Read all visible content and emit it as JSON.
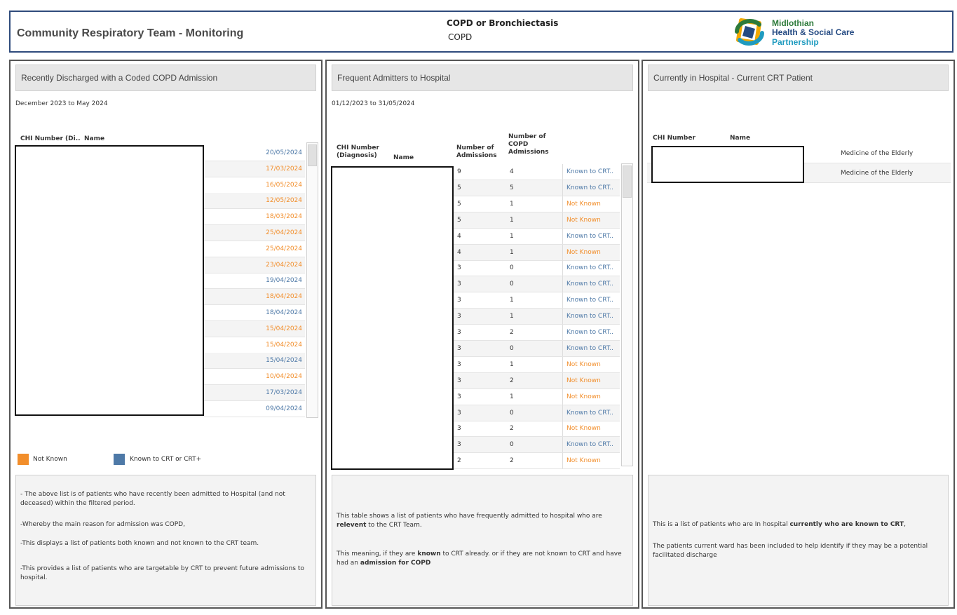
{
  "header": {
    "title": "Community Respiratory Team - Monitoring",
    "filter_primary": "COPD or Bronchiectasis",
    "filter_secondary": "COPD",
    "logo_line1": "Midlothian",
    "logo_line2": "Health & Social Care",
    "logo_line3": "Partnership"
  },
  "colors": {
    "not_known": "#f28e2b",
    "known": "#4e79a7",
    "header_border": "#2f4b7c"
  },
  "panel1": {
    "title": "Recently Discharged with a Coded COPD Admission",
    "period": "December 2023 to May 2024",
    "col_chi": "CHI Number (Di..",
    "col_name": "Name",
    "rows": [
      {
        "date": "20/05/2024",
        "status": "known"
      },
      {
        "date": "17/03/2024",
        "status": "not_known"
      },
      {
        "date": "16/05/2024",
        "status": "not_known"
      },
      {
        "date": "12/05/2024",
        "status": "not_known"
      },
      {
        "date": "18/03/2024",
        "status": "not_known"
      },
      {
        "date": "25/04/2024",
        "status": "not_known"
      },
      {
        "date": "25/04/2024",
        "status": "not_known"
      },
      {
        "date": "23/04/2024",
        "status": "not_known"
      },
      {
        "date": "19/04/2024",
        "status": "known"
      },
      {
        "date": "18/04/2024",
        "status": "not_known"
      },
      {
        "date": "18/04/2024",
        "status": "known"
      },
      {
        "date": "15/04/2024",
        "status": "not_known"
      },
      {
        "date": "15/04/2024",
        "status": "not_known"
      },
      {
        "date": "15/04/2024",
        "status": "known"
      },
      {
        "date": "10/04/2024",
        "status": "not_known"
      },
      {
        "date": "17/03/2024",
        "status": "known"
      },
      {
        "date": "09/04/2024",
        "status": "known"
      }
    ],
    "legend": {
      "not_known": "Not Known",
      "known": "Known to CRT or CRT+"
    },
    "notes": [
      "- The above list is of patients who have recently been admitted to Hospital (and not deceased) within the filtered period.",
      "-Whereby the main reason for admission was COPD,",
      "-This displays a list of patients both known and not known to the CRT team.",
      "-This provides a list of patients who are targetable by CRT to prevent future admissions to hospital."
    ]
  },
  "panel2": {
    "title": "Frequent Admitters to Hospital",
    "period": "01/12/2023 to 31/05/2024",
    "col_chi": "CHI Number (Diagnosis)",
    "col_name": "Name",
    "col_adm": "Number of Admissions",
    "col_copd": "Number of COPD Admissions",
    "rows": [
      {
        "adm": "9",
        "copd": "4",
        "status": "Known to CRT..",
        "kind": "known"
      },
      {
        "adm": "5",
        "copd": "5",
        "status": "Known to CRT..",
        "kind": "known"
      },
      {
        "adm": "5",
        "copd": "1",
        "status": "Not Known",
        "kind": "not_known"
      },
      {
        "adm": "5",
        "copd": "1",
        "status": "Not Known",
        "kind": "not_known"
      },
      {
        "adm": "4",
        "copd": "1",
        "status": "Known to CRT..",
        "kind": "known"
      },
      {
        "adm": "4",
        "copd": "1",
        "status": "Not Known",
        "kind": "not_known"
      },
      {
        "adm": "3",
        "copd": "0",
        "status": "Known to CRT..",
        "kind": "known"
      },
      {
        "adm": "3",
        "copd": "0",
        "status": "Known to CRT..",
        "kind": "known"
      },
      {
        "adm": "3",
        "copd": "1",
        "status": "Known to CRT..",
        "kind": "known"
      },
      {
        "adm": "3",
        "copd": "1",
        "status": "Known to CRT..",
        "kind": "known"
      },
      {
        "adm": "3",
        "copd": "2",
        "status": "Known to CRT..",
        "kind": "known"
      },
      {
        "adm": "3",
        "copd": "0",
        "status": "Known to CRT..",
        "kind": "known"
      },
      {
        "adm": "3",
        "copd": "1",
        "status": "Not Known",
        "kind": "not_known"
      },
      {
        "adm": "3",
        "copd": "2",
        "status": "Not Known",
        "kind": "not_known"
      },
      {
        "adm": "3",
        "copd": "1",
        "status": "Not Known",
        "kind": "not_known"
      },
      {
        "adm": "3",
        "copd": "0",
        "status": "Known to CRT..",
        "kind": "known"
      },
      {
        "adm": "3",
        "copd": "2",
        "status": "Not Known",
        "kind": "not_known"
      },
      {
        "adm": "3",
        "copd": "0",
        "status": "Known to CRT..",
        "kind": "known"
      },
      {
        "adm": "2",
        "copd": "2",
        "status": "Not Known",
        "kind": "not_known"
      }
    ],
    "note1_a": "This table shows a list of patients who have frequently admitted to hospital who are ",
    "note1_b": "relevent",
    "note1_c": " to the CRT Team.",
    "note2_a": "This meaning, if they are ",
    "note2_b": "known",
    "note2_c": " to CRT already. or if they are not known to CRT and have had an ",
    "note2_d": "admission for COPD"
  },
  "panel3": {
    "title": "Currently in Hospital - Current CRT Patient",
    "col_chi": "CHI Number",
    "col_name": "Name",
    "rows": [
      {
        "ward": "Medicine of the Elderly"
      },
      {
        "ward": "Medicine of the Elderly"
      }
    ],
    "note1_a": "This is a list of patients who are In hospital ",
    "note1_b": "currently who are known to CRT",
    "note1_c": ",",
    "note2": "The patients current ward has been included to help identify if they may be a potential facilitated discharge"
  }
}
